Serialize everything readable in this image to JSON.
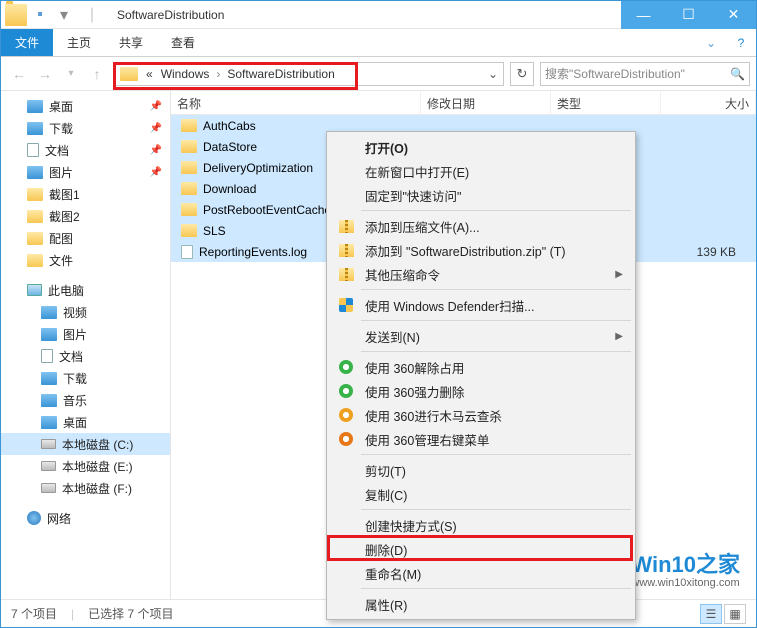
{
  "window": {
    "title": "SoftwareDistribution"
  },
  "ribbon": {
    "file": "文件",
    "tabs": [
      "主页",
      "共享",
      "查看"
    ]
  },
  "address": {
    "prefix": "«",
    "crumbs": [
      "Windows",
      "SoftwareDistribution"
    ]
  },
  "search": {
    "placeholder": "搜索\"SoftwareDistribution\""
  },
  "nav": {
    "quick": [
      {
        "label": "桌面",
        "pin": true,
        "ico": "blue"
      },
      {
        "label": "下载",
        "pin": true,
        "ico": "blue"
      },
      {
        "label": "文档",
        "pin": true,
        "ico": "doc"
      },
      {
        "label": "图片",
        "pin": true,
        "ico": "blue"
      },
      {
        "label": "截图1",
        "pin": false,
        "ico": "folder"
      },
      {
        "label": "截图2",
        "pin": false,
        "ico": "folder"
      },
      {
        "label": "配图",
        "pin": false,
        "ico": "folder"
      },
      {
        "label": "文件",
        "pin": false,
        "ico": "folder"
      }
    ],
    "thispc_label": "此电脑",
    "thispc": [
      {
        "label": "视频",
        "ico": "blue"
      },
      {
        "label": "图片",
        "ico": "blue"
      },
      {
        "label": "文档",
        "ico": "doc"
      },
      {
        "label": "下载",
        "ico": "blue"
      },
      {
        "label": "音乐",
        "ico": "blue"
      },
      {
        "label": "桌面",
        "ico": "blue"
      },
      {
        "label": "本地磁盘 (C:)",
        "ico": "drive",
        "sel": true
      },
      {
        "label": "本地磁盘 (E:)",
        "ico": "drive"
      },
      {
        "label": "本地磁盘 (F:)",
        "ico": "drive"
      }
    ],
    "network": "网络"
  },
  "columns": {
    "name": "名称",
    "date": "修改日期",
    "type": "类型",
    "size": "大小"
  },
  "files": [
    {
      "name": "AuthCabs",
      "type": "folder"
    },
    {
      "name": "DataStore",
      "type": "folder"
    },
    {
      "name": "DeliveryOptimization",
      "type": "folder"
    },
    {
      "name": "Download",
      "type": "folder"
    },
    {
      "name": "PostRebootEventCache.V2",
      "type": "folder"
    },
    {
      "name": "SLS",
      "type": "folder"
    },
    {
      "name": "ReportingEvents.log",
      "type": "txt",
      "size": "139 KB"
    }
  ],
  "context_menu": [
    {
      "label": "打开(O)",
      "bold": true
    },
    {
      "label": "在新窗口中打开(E)"
    },
    {
      "label": "固定到\"快速访问\""
    },
    {
      "sep": true
    },
    {
      "label": "添加到压缩文件(A)...",
      "icon": "zip"
    },
    {
      "label": "添加到 \"SoftwareDistribution.zip\" (T)",
      "icon": "zip"
    },
    {
      "label": "其他压缩命令",
      "icon": "zip",
      "sub": true
    },
    {
      "sep": true
    },
    {
      "label": "使用 Windows Defender扫描...",
      "icon": "shield"
    },
    {
      "sep": true
    },
    {
      "label": "发送到(N)",
      "sub": true
    },
    {
      "sep": true
    },
    {
      "label": "使用 360解除占用",
      "icon": "g360"
    },
    {
      "label": "使用 360强力删除",
      "icon": "g360"
    },
    {
      "label": "使用 360进行木马云查杀",
      "icon": "g360y"
    },
    {
      "label": "使用 360管理右键菜单",
      "icon": "g360o"
    },
    {
      "sep": true
    },
    {
      "label": "剪切(T)"
    },
    {
      "label": "复制(C)"
    },
    {
      "sep": true
    },
    {
      "label": "创建快捷方式(S)"
    },
    {
      "label": "删除(D)",
      "hl": true
    },
    {
      "label": "重命名(M)"
    },
    {
      "sep": true
    },
    {
      "label": "属性(R)"
    }
  ],
  "status": {
    "count": "7 个项目",
    "selected": "已选择 7 个项目"
  },
  "watermark": {
    "title": "Win10之家",
    "url": "www.win10xitong.com"
  }
}
